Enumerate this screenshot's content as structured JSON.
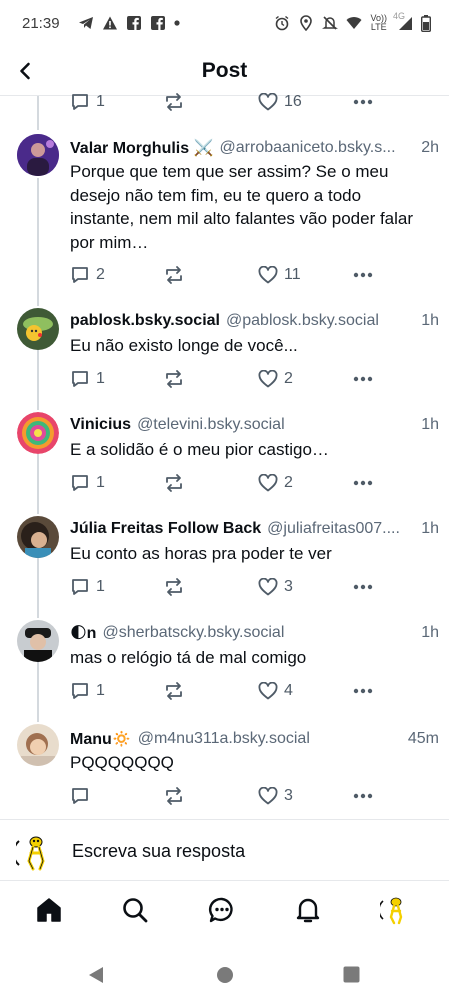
{
  "status_bar": {
    "time": "21:39",
    "network_label_top": "Vo))",
    "network_label_bottom": "LTE",
    "network_4g": "4G"
  },
  "header": {
    "back_icon": "chevron-left-icon",
    "title": "Post"
  },
  "top_actions": {
    "replies": "1",
    "reposts": "",
    "likes": "16"
  },
  "posts": [
    {
      "name": "Valar Morghulis ⚔️",
      "handle": "@arrobaaniceto.bsky.s...",
      "time": "2h",
      "text": "Porque que tem que ser assim? Se o meu desejo não tem fim, eu te quero a todo instante, nem mil alto falantes vão poder falar por mim…",
      "replies": "2",
      "likes": "11"
    },
    {
      "name": "pablosk.bsky.social",
      "handle": "@pablosk.bsky.social",
      "time": "1h",
      "text": "Eu não existo longe de você...",
      "replies": "1",
      "likes": "2"
    },
    {
      "name": "Vinicius",
      "handle": "@televini.bsky.social",
      "time": "1h",
      "text": "E a solidão é o meu pior castigo…",
      "replies": "1",
      "likes": "2"
    },
    {
      "name": "Júlia Freitas Follow Back",
      "handle": "@juliafreitas007....",
      "time": "1h",
      "text": "Eu conto as horas pra poder te ver",
      "replies": "1",
      "likes": "3"
    },
    {
      "name": "🌓n",
      "handle": "@sherbatscky.bsky.social",
      "time": "1h",
      "text": "mas o relógio tá de mal comigo",
      "replies": "1",
      "likes": "4"
    },
    {
      "name": "Manu🔅",
      "handle": "@m4nu311a.bsky.social",
      "time": "45m",
      "text": "PQQQQQQQ",
      "replies": "",
      "likes": "3"
    }
  ],
  "reply_bar": {
    "placeholder": "Escreva sua resposta"
  },
  "bottom_nav": [
    "home-icon",
    "search-icon",
    "chat-icon",
    "bell-icon",
    "profile-avatar"
  ],
  "colors": {
    "accent": "#1185fe",
    "text": "#0b0f14",
    "muted": "#5b6877",
    "icon": "#4f5b67",
    "divider": "#e6e8eb"
  }
}
